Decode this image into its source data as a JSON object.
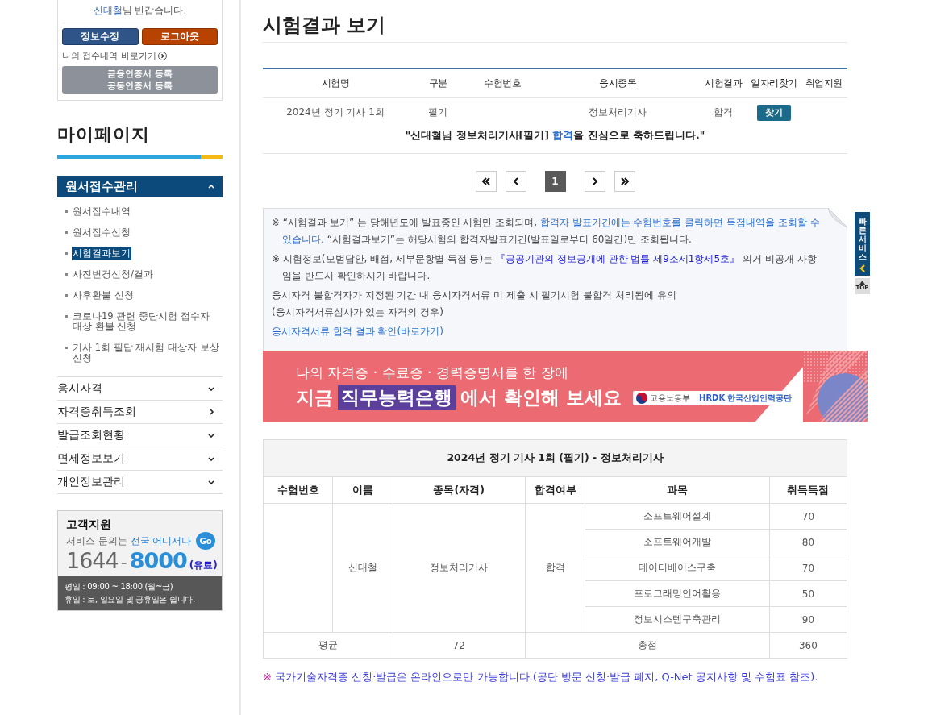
{
  "sidebar": {
    "login": {
      "user_name": "신대철",
      "greeting": "님 반갑습니다.",
      "buttons": [
        {
          "label": "정보수정",
          "kind": "edit"
        },
        {
          "label": "로그아웃",
          "kind": "logout"
        }
      ],
      "link": "나의 접수내역 바로가기",
      "cert_buttons": [
        "금융인증서 등록",
        "공동인증서 등록"
      ]
    },
    "title": "마이페이지",
    "menu": [
      {
        "label": "원서접수관리",
        "kind": "group",
        "expanded": true,
        "children": [
          {
            "label": "원서접수내역",
            "selected": false
          },
          {
            "label": "원서접수신청",
            "selected": false
          },
          {
            "label": "시험결과보기",
            "selected": true
          },
          {
            "label": "사진변경신청/결과",
            "selected": false
          },
          {
            "label": "사후환불 신청",
            "selected": false
          },
          {
            "label": "코로나19 관련 중단시험 접수자 대상 환불 신청",
            "selected": false
          },
          {
            "label": "기사 1회 필답 재시험 대상자 보상 신청",
            "selected": false
          }
        ]
      },
      {
        "label": "응시자격",
        "kind": "group",
        "expanded": false
      },
      {
        "label": "자격증취득조회",
        "kind": "link",
        "expanded": false
      },
      {
        "label": "발급조회현황",
        "kind": "group",
        "expanded": false
      },
      {
        "label": "면제정보보기",
        "kind": "group",
        "expanded": false
      },
      {
        "label": "개인정보관리",
        "kind": "group",
        "expanded": false
      }
    ],
    "support": {
      "title": "고객지원",
      "text": "서비스 문의는",
      "highlight": "전국 어디서나",
      "go": "Go",
      "phone_a": "1644",
      "phone_sep": "-",
      "phone_b": "8000",
      "paid": "(유료)",
      "hours": [
        "평일 : 09:00 ~ 18:00 (월~금)",
        "휴일 : 토, 일요일 및 공휴일은 쉽니다."
      ]
    }
  },
  "main": {
    "title": "시험결과 보기",
    "results": {
      "columns": [
        "시험명",
        "구분",
        "수험번호",
        "응시종목",
        "시험결과",
        "일자리찾기",
        "취업지원"
      ],
      "rows": [
        {
          "exam": "2024년 정기 기사 1회",
          "category": "필기",
          "subject": "정보처리기사",
          "result": "합격",
          "job_button": "찾기"
        }
      ]
    },
    "congrats": {
      "before": "\"신대철님 정보처리기사[필기] ",
      "highlight": "합격",
      "after": "을 진심으로 축하드립니다.\""
    },
    "pagination": {
      "pages": [
        {
          "label": "1",
          "selected": true
        }
      ]
    },
    "notices": [
      {
        "kind": "mark",
        "segments": [
          {
            "text": "※ “시험결과 보기” 는 당해년도에 발표중인 시험만 조회되며, ",
            "kind": "plain"
          },
          {
            "text": "합격자 발표기간에는 수험번호를 클릭하면 득점내역을 조회할 수 있습니다.",
            "kind": "blue"
          },
          {
            "text": " “시험결과보기”는 해당시험의 합격자발표기간(발표일로부터 60일간)만 조회됩니다.",
            "kind": "plain"
          }
        ]
      },
      {
        "kind": "mark",
        "segments": [
          {
            "text": "※ 시험정보(모범답안, 배점, 세부문항별 득점 등)는 ",
            "kind": "plain"
          },
          {
            "text": "『공공기관의 정보공개에 관한 법률 제9조제1항제5호』",
            "kind": "law"
          },
          {
            "text": " 의거 비공개 사항임을 반드시 확인하시기 바랍니다.",
            "kind": "plain"
          }
        ]
      },
      {
        "kind": "plain",
        "segments": [
          {
            "text": "응시자격 불합격자가 지정된 기간 내 응시자격서류 미 제출 시 필기시험 불합격 처리됨에 유의",
            "kind": "plain"
          }
        ]
      },
      {
        "kind": "plain",
        "segments": [
          {
            "text": "(응시자격서류심사가 있는 자격의 경우)",
            "kind": "plain"
          }
        ]
      },
      {
        "kind": "link",
        "segments": [
          {
            "text": "응시자격서류 합격 결과 확인(바로가기)",
            "kind": "blue"
          }
        ]
      }
    ],
    "banner": {
      "line1": "나의 자격증 · 수료증 · 경력증명서를 한 장에",
      "line2_a": "지금",
      "line2_highlight": "직무능력은행",
      "line2_b": "에서 확인해 보세요",
      "ministry": "고용노동부",
      "agency_mark": "HRDK",
      "agency": "한국산업인력공단"
    },
    "score_table": {
      "caption": "2024년 정기 기사 1회 (필기) - 정보처리기사",
      "columns": [
        "수험번호",
        "이름",
        "종목(자격)",
        "합격여부",
        "과목",
        "취득득점"
      ],
      "candidate": {
        "name": "신대철",
        "subject": "정보처리기사",
        "result": "합격"
      },
      "subjects": [
        {
          "name": "소프트웨어설계",
          "score": "70"
        },
        {
          "name": "소프트웨어개발",
          "score": "80"
        },
        {
          "name": "데이터베이스구축",
          "score": "70"
        },
        {
          "name": "프로그래밍언어활용",
          "score": "50"
        },
        {
          "name": "정보시스템구축관리",
          "score": "90"
        }
      ],
      "average_label": "평균",
      "average": "72",
      "total_label": "총점",
      "total": "360"
    },
    "footnote": {
      "mark": "※",
      "text": "국가기술자격증 신청·발급은 온라인으로만 가능합니다.(공단 방문 신청·발급 폐지, Q-Net 공지사항 및 수험표 참조)."
    }
  },
  "quick_menu": {
    "label": "빠른서비스",
    "top": "TOP"
  }
}
